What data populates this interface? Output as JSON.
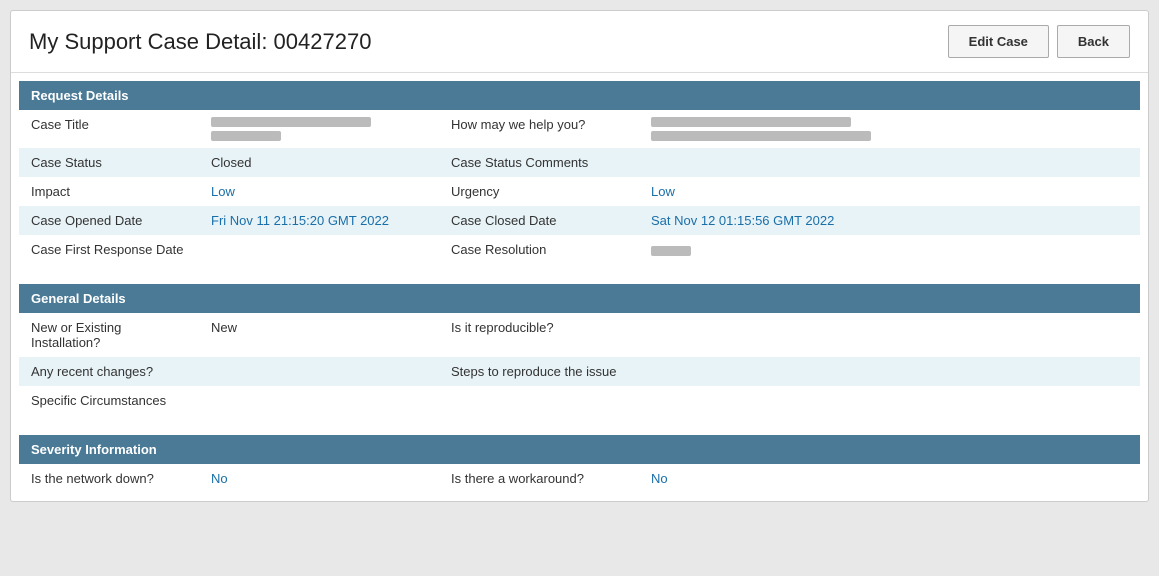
{
  "header": {
    "title": "My Support Case Detail: 00427270",
    "edit_button": "Edit Case",
    "back_button": "Back"
  },
  "request_details": {
    "section_title": "Request Details",
    "rows": [
      {
        "label1": "Case Title",
        "value1_blurred": true,
        "label2": "How may we help you?",
        "value2_blurred": true
      },
      {
        "label1": "Case Status",
        "value1": "Closed",
        "value1_color": "black",
        "label2": "Case Status Comments",
        "value2": "",
        "value2_color": "black"
      },
      {
        "label1": "Impact",
        "value1": "Low",
        "value1_color": "blue",
        "label2": "Urgency",
        "value2": "Low",
        "value2_color": "blue"
      },
      {
        "label1": "Case Opened Date",
        "value1": "Fri Nov 11 21:15:20 GMT 2022",
        "value1_color": "blue",
        "label2": "Case Closed Date",
        "value2": "Sat Nov 12 01:15:56 GMT 2022",
        "value2_color": "blue"
      },
      {
        "label1": "Case First Response Date",
        "value1": "",
        "value1_color": "black",
        "label2": "Case Resolution",
        "value2_blurred": true,
        "value2_color": "black"
      }
    ]
  },
  "general_details": {
    "section_title": "General Details",
    "rows": [
      {
        "label1": "New or Existing Installation?",
        "value1": "New",
        "value1_color": "black",
        "label2": "Is it reproducible?",
        "value2": "",
        "value2_color": "black"
      },
      {
        "label1": "Any recent changes?",
        "value1": "",
        "value1_color": "black",
        "label2": "Steps to reproduce the issue",
        "value2": "",
        "value2_color": "black"
      },
      {
        "label1": "Specific Circumstances",
        "value1": "",
        "value1_color": "black",
        "label2": "",
        "value2": "",
        "value2_color": "black"
      }
    ]
  },
  "severity_information": {
    "section_title": "Severity Information",
    "rows": [
      {
        "label1": "Is the network down?",
        "value1": "No",
        "value1_color": "blue",
        "label2": "Is there a workaround?",
        "value2": "No",
        "value2_color": "blue"
      }
    ]
  }
}
